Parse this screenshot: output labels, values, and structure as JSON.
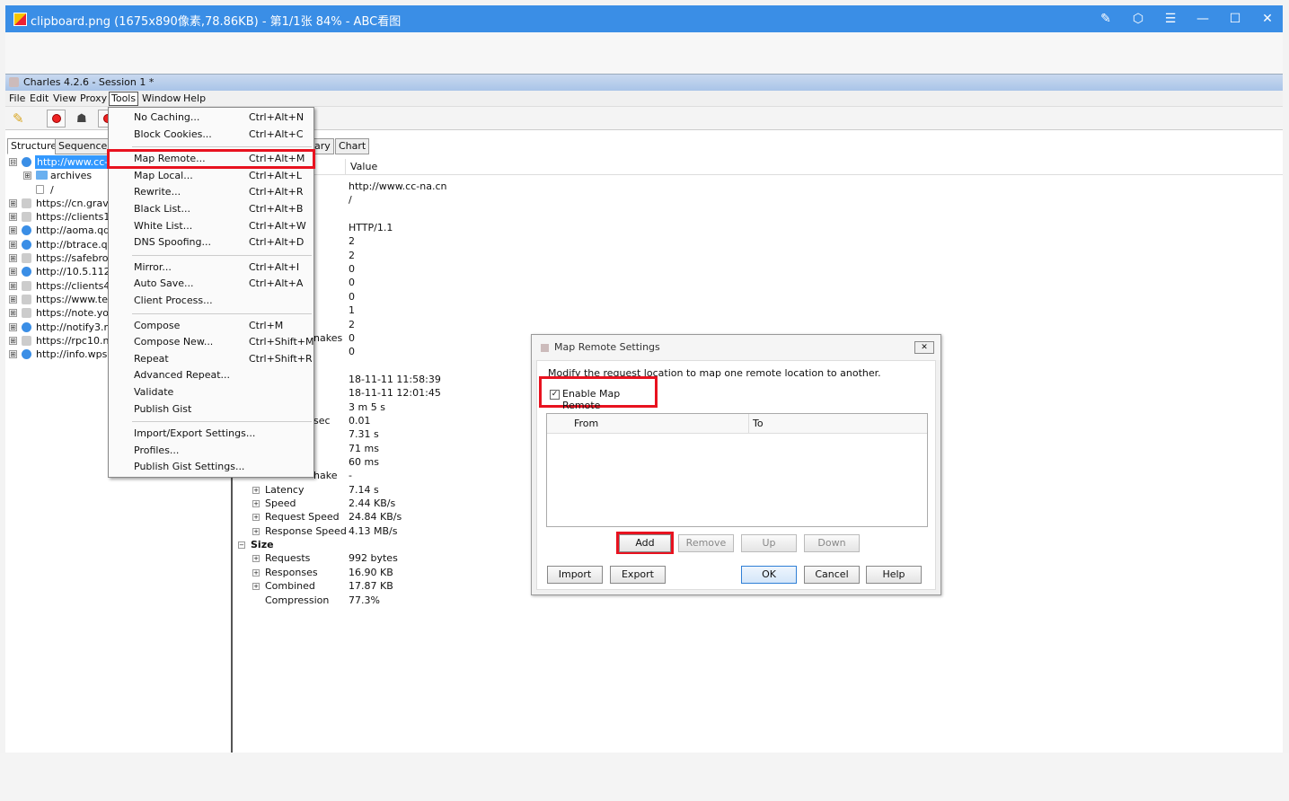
{
  "viewer": {
    "title": "clipboard.png (1675x890像素,78.86KB) - 第1/1张 84% - ABC看图",
    "controls": [
      "✎",
      "⬡",
      "☰",
      "—",
      "☐",
      "✕"
    ]
  },
  "charles": {
    "title": "Charles 4.2.6 - Session 1 *",
    "menu": [
      "File",
      "Edit",
      "View",
      "Proxy",
      "Tools",
      "Window",
      "Help"
    ],
    "left_tabs": [
      "Structure",
      "Sequence"
    ],
    "tree": [
      {
        "label": "http://www.cc-na.cn",
        "icon": "globe-icon",
        "selected": true,
        "expander": "⊟"
      },
      {
        "label": "archives",
        "icon": "folder-icon",
        "kind": "child",
        "expander": "⊞"
      },
      {
        "label": "/",
        "icon": "file-icon",
        "kind": "grandchild"
      },
      {
        "label": "https://cn.gravat",
        "icon": "lock-icon",
        "expander": "⊞"
      },
      {
        "label": "https://clients1.g",
        "icon": "lock-icon",
        "expander": "⊞"
      },
      {
        "label": "http://aoma.qq.c",
        "icon": "globe-icon",
        "expander": "⊞"
      },
      {
        "label": "http://btrace.qq.",
        "icon": "globe-icon",
        "expander": "⊞"
      },
      {
        "label": "https://safebrow",
        "icon": "lock-icon",
        "expander": "⊞"
      },
      {
        "label": "http://10.5.112.2",
        "icon": "globe-icon",
        "expander": "⊞"
      },
      {
        "label": "https://clients4.g",
        "icon": "lock-icon",
        "expander": "⊞"
      },
      {
        "label": "https://www.tear",
        "icon": "lock-icon",
        "expander": "⊞"
      },
      {
        "label": "https://note.you",
        "icon": "lock-icon",
        "expander": "⊞"
      },
      {
        "label": "http://notify3.no",
        "icon": "globe-icon",
        "expander": "⊞"
      },
      {
        "label": "https://rpc10.no",
        "icon": "lock-icon",
        "expander": "⊞"
      },
      {
        "label": "http://info.wps.c",
        "icon": "globe-icon",
        "expander": "⊞"
      }
    ],
    "right_tabs": [
      "ary",
      "Chart"
    ],
    "grid_header_value": "Value",
    "rows": [
      {
        "name": "",
        "value": "http://www.cc-na.cn"
      },
      {
        "name": "",
        "value": "/"
      },
      {
        "name": "",
        "value": ""
      },
      {
        "name": "",
        "value": "HTTP/1.1"
      },
      {
        "name": "",
        "value": "2"
      },
      {
        "name": "",
        "value": "2"
      },
      {
        "name": "",
        "value": "0"
      },
      {
        "name": "",
        "value": "0"
      },
      {
        "name": "",
        "value": "0"
      },
      {
        "name": "",
        "value": "1"
      },
      {
        "name": "",
        "value": "2"
      },
      {
        "name": "nakes",
        "value": "0"
      },
      {
        "name": "",
        "value": "0"
      },
      {
        "name": "",
        "value": ""
      },
      {
        "name": "",
        "value": "18-11-11 11:58:39"
      },
      {
        "name": "",
        "value": "18-11-11 12:01:45"
      },
      {
        "name": "",
        "value": "3 m 5 s"
      },
      {
        "name": "sec",
        "value": "0.01"
      },
      {
        "name": "",
        "value": "7.31 s"
      },
      {
        "name": "",
        "value": "71 ms"
      },
      {
        "name": "",
        "value": "60 ms"
      },
      {
        "name": "hake",
        "value": "-"
      },
      {
        "name": "Latency",
        "value": "7.14 s",
        "exp": true
      },
      {
        "name": "Speed",
        "value": "2.44 KB/s",
        "exp": true
      },
      {
        "name": "Request Speed",
        "value": "24.84 KB/s",
        "exp": true
      },
      {
        "name": "Response Speed",
        "value": "4.13 MB/s",
        "exp": true
      },
      {
        "name": "Size",
        "value": "",
        "group": true
      },
      {
        "name": "Requests",
        "value": "992 bytes",
        "exp": true
      },
      {
        "name": "Responses",
        "value": "16.90 KB",
        "exp": true
      },
      {
        "name": "Combined",
        "value": "17.87 KB",
        "exp": true
      },
      {
        "name": "Compression",
        "value": "77.3%"
      }
    ]
  },
  "tools_menu": {
    "groups": [
      [
        {
          "label": "No Caching...",
          "shortcut": "Ctrl+Alt+N"
        },
        {
          "label": "Block Cookies...",
          "shortcut": "Ctrl+Alt+C"
        }
      ],
      [
        {
          "label": "Map Remote...",
          "shortcut": "Ctrl+Alt+M",
          "highlight": true
        },
        {
          "label": "Map Local...",
          "shortcut": "Ctrl+Alt+L"
        },
        {
          "label": "Rewrite...",
          "shortcut": "Ctrl+Alt+R"
        },
        {
          "label": "Black List...",
          "shortcut": "Ctrl+Alt+B"
        },
        {
          "label": "White List...",
          "shortcut": "Ctrl+Alt+W"
        },
        {
          "label": "DNS Spoofing...",
          "shortcut": "Ctrl+Alt+D"
        }
      ],
      [
        {
          "label": "Mirror...",
          "shortcut": "Ctrl+Alt+I"
        },
        {
          "label": "Auto Save...",
          "shortcut": "Ctrl+Alt+A"
        },
        {
          "label": "Client Process...",
          "shortcut": ""
        }
      ],
      [
        {
          "label": "Compose",
          "shortcut": "Ctrl+M"
        },
        {
          "label": "Compose New...",
          "shortcut": "Ctrl+Shift+M"
        },
        {
          "label": "Repeat",
          "shortcut": "Ctrl+Shift+R"
        },
        {
          "label": "Advanced Repeat...",
          "shortcut": ""
        },
        {
          "label": "Validate",
          "shortcut": ""
        },
        {
          "label": "Publish Gist",
          "shortcut": ""
        }
      ],
      [
        {
          "label": "Import/Export Settings...",
          "shortcut": ""
        },
        {
          "label": "Profiles...",
          "shortcut": ""
        },
        {
          "label": "Publish Gist Settings...",
          "shortcut": ""
        }
      ]
    ]
  },
  "dialog": {
    "title": "Map Remote Settings",
    "description": "Modify the request location to map one remote location to another.",
    "enable_label": "Enable Map Remote",
    "enabled": true,
    "columns": [
      "From",
      "To"
    ],
    "buttons": {
      "add": "Add",
      "remove": "Remove",
      "up": "Up",
      "down": "Down",
      "import": "Import",
      "export": "Export",
      "ok": "OK",
      "cancel": "Cancel",
      "help": "Help"
    }
  },
  "colors": {
    "highlight": "#e8121f",
    "titlebar": "#3a8ee6",
    "selection": "#3399ff"
  }
}
